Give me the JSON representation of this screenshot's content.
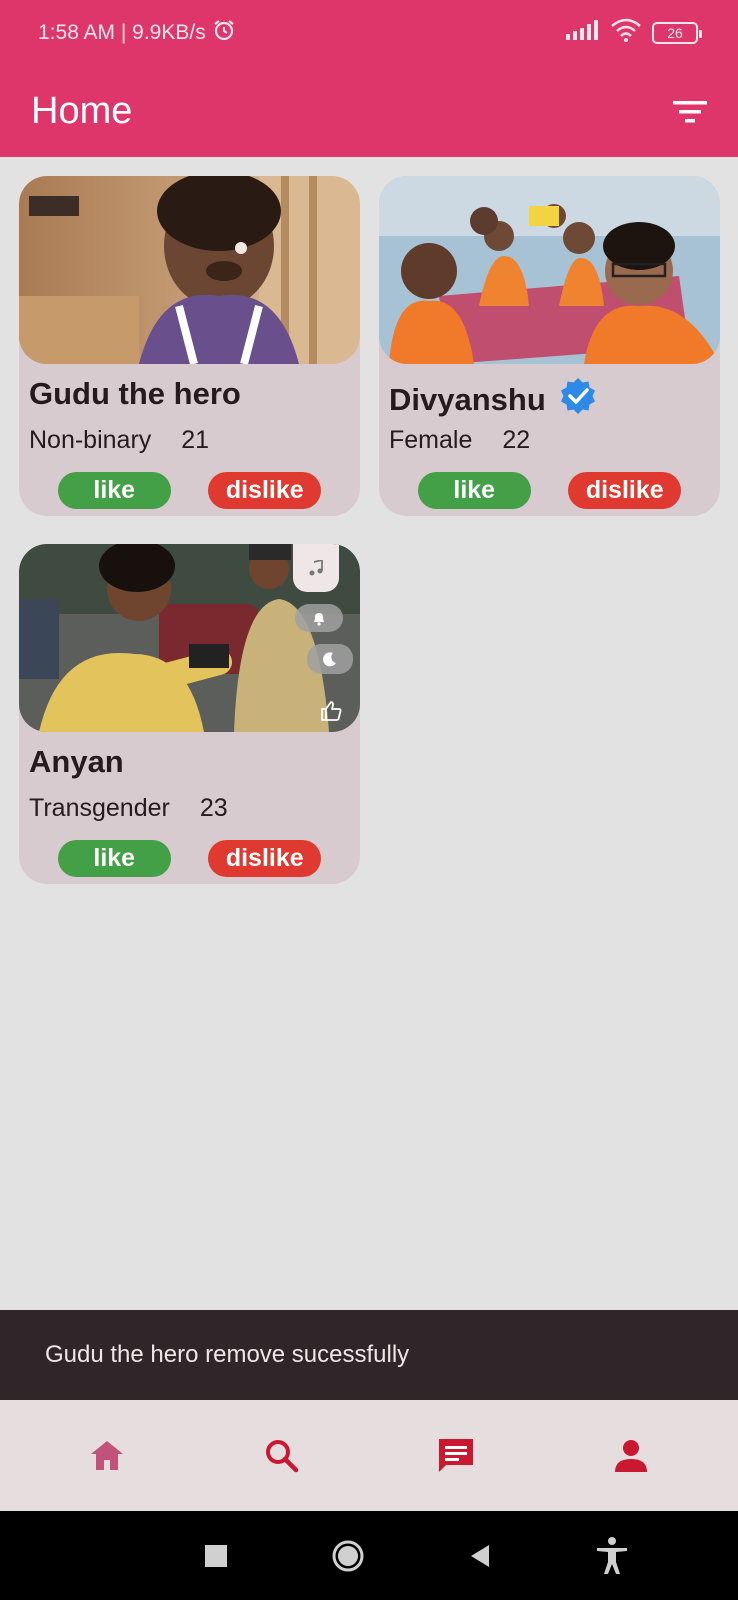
{
  "status_bar": {
    "time_speed": "1:58 AM | 9.9KB/s",
    "battery": "26"
  },
  "header": {
    "title": "Home",
    "filter_icon": "filter-icon"
  },
  "cards": [
    {
      "name": "Gudu the hero",
      "gender": "Non-binary",
      "age": "21",
      "verified": false,
      "like_label": "like",
      "dislike_label": "dislike"
    },
    {
      "name": "Divyanshu",
      "gender": "Female",
      "age": "22",
      "verified": true,
      "like_label": "like",
      "dislike_label": "dislike"
    },
    {
      "name": "Anyan",
      "gender": "Transgender",
      "age": "23",
      "verified": false,
      "like_label": "like",
      "dislike_label": "dislike"
    }
  ],
  "snackbar": {
    "message": "Gudu the hero remove sucessfully"
  },
  "bottom_nav": {
    "items": [
      "home-icon",
      "search-icon",
      "chat-icon",
      "profile-icon"
    ]
  },
  "colors": {
    "primary": "#de356b",
    "like": "#43a047",
    "dislike": "#e0392f",
    "card_bg": "#d8cbcf",
    "verified": "#2d8ae6"
  }
}
